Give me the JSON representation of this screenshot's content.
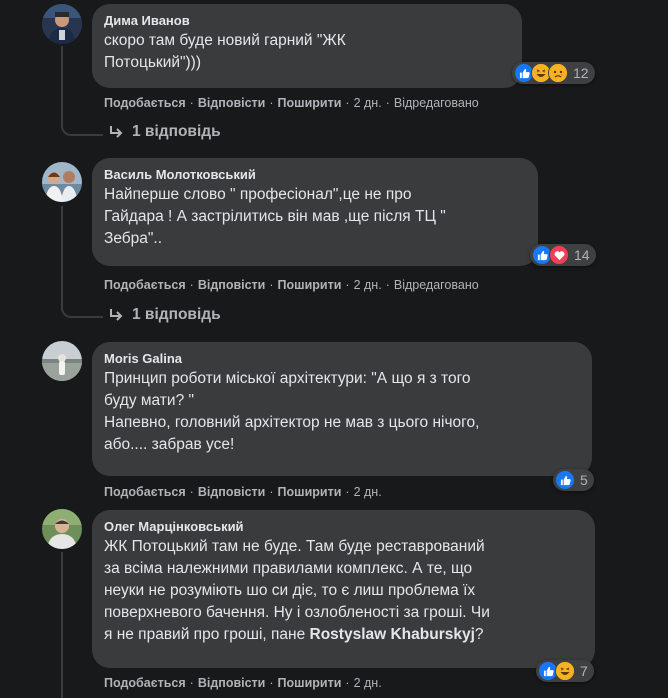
{
  "comments": [
    {
      "author": "Дима Иванов",
      "lines": [
        "скоро там буде новий гарний \"ЖК",
        "Потоцький\")))"
      ],
      "reaction_count": "12",
      "reactions": [
        "like",
        "haha",
        "sad"
      ],
      "actions": {
        "like": "Подобається",
        "reply": "Відповісти",
        "share": "Поширити",
        "time": "2 дн.",
        "edited": "Відредаговано"
      },
      "replies_label": "1 відповідь"
    },
    {
      "author": "Василь Молотковський",
      "lines": [
        "Найперше слово \" професіонал\",це не про",
        "Гайдара ! А застрілитись він мав ,ще після ТЦ \"",
        "Зебра\".."
      ],
      "reaction_count": "14",
      "reactions": [
        "like",
        "love"
      ],
      "actions": {
        "like": "Подобається",
        "reply": "Відповісти",
        "share": "Поширити",
        "time": "2 дн.",
        "edited": "Відредаговано"
      },
      "replies_label": "1 відповідь"
    },
    {
      "author": "Moris Galina",
      "lines": [
        "Принцип роботи міської архітектури: \"А що я з того",
        "буду мати? \"",
        "Напевно, головний архітектор не мав з цього нічого,",
        "або.... забрав усе!"
      ],
      "reaction_count": "5",
      "reactions": [
        "like"
      ],
      "actions": {
        "like": "Подобається",
        "reply": "Відповісти",
        "share": "Поширити",
        "time": "2 дн."
      }
    },
    {
      "author": "Олег Марцінковський",
      "lines": [
        "ЖК Потоцький там не буде. Там буде реставрований",
        "за всіма належними правилами комплекс. А те, що",
        "неуки не розуміють шо си діє, то є лиш проблема їх",
        "поверхневого бачення. Ну і озлобленості за гроші. Чи"
      ],
      "last_line_prefix": "я не правий про гроші, пане ",
      "mention": "Rostyslaw Khaburskyj",
      "last_line_suffix": "?",
      "reaction_count": "7",
      "reactions": [
        "like",
        "haha"
      ],
      "actions": {
        "like": "Подобається",
        "reply": "Відповісти",
        "share": "Поширити",
        "time": "2 дн."
      }
    }
  ],
  "colors": {
    "background": "#18191a",
    "bubble": "#3a3b3c",
    "text": "#e4e6eb",
    "secondary": "#b0b3b8",
    "like": "#1877f2",
    "love": "#f33e58",
    "haha": "#f7b125"
  }
}
